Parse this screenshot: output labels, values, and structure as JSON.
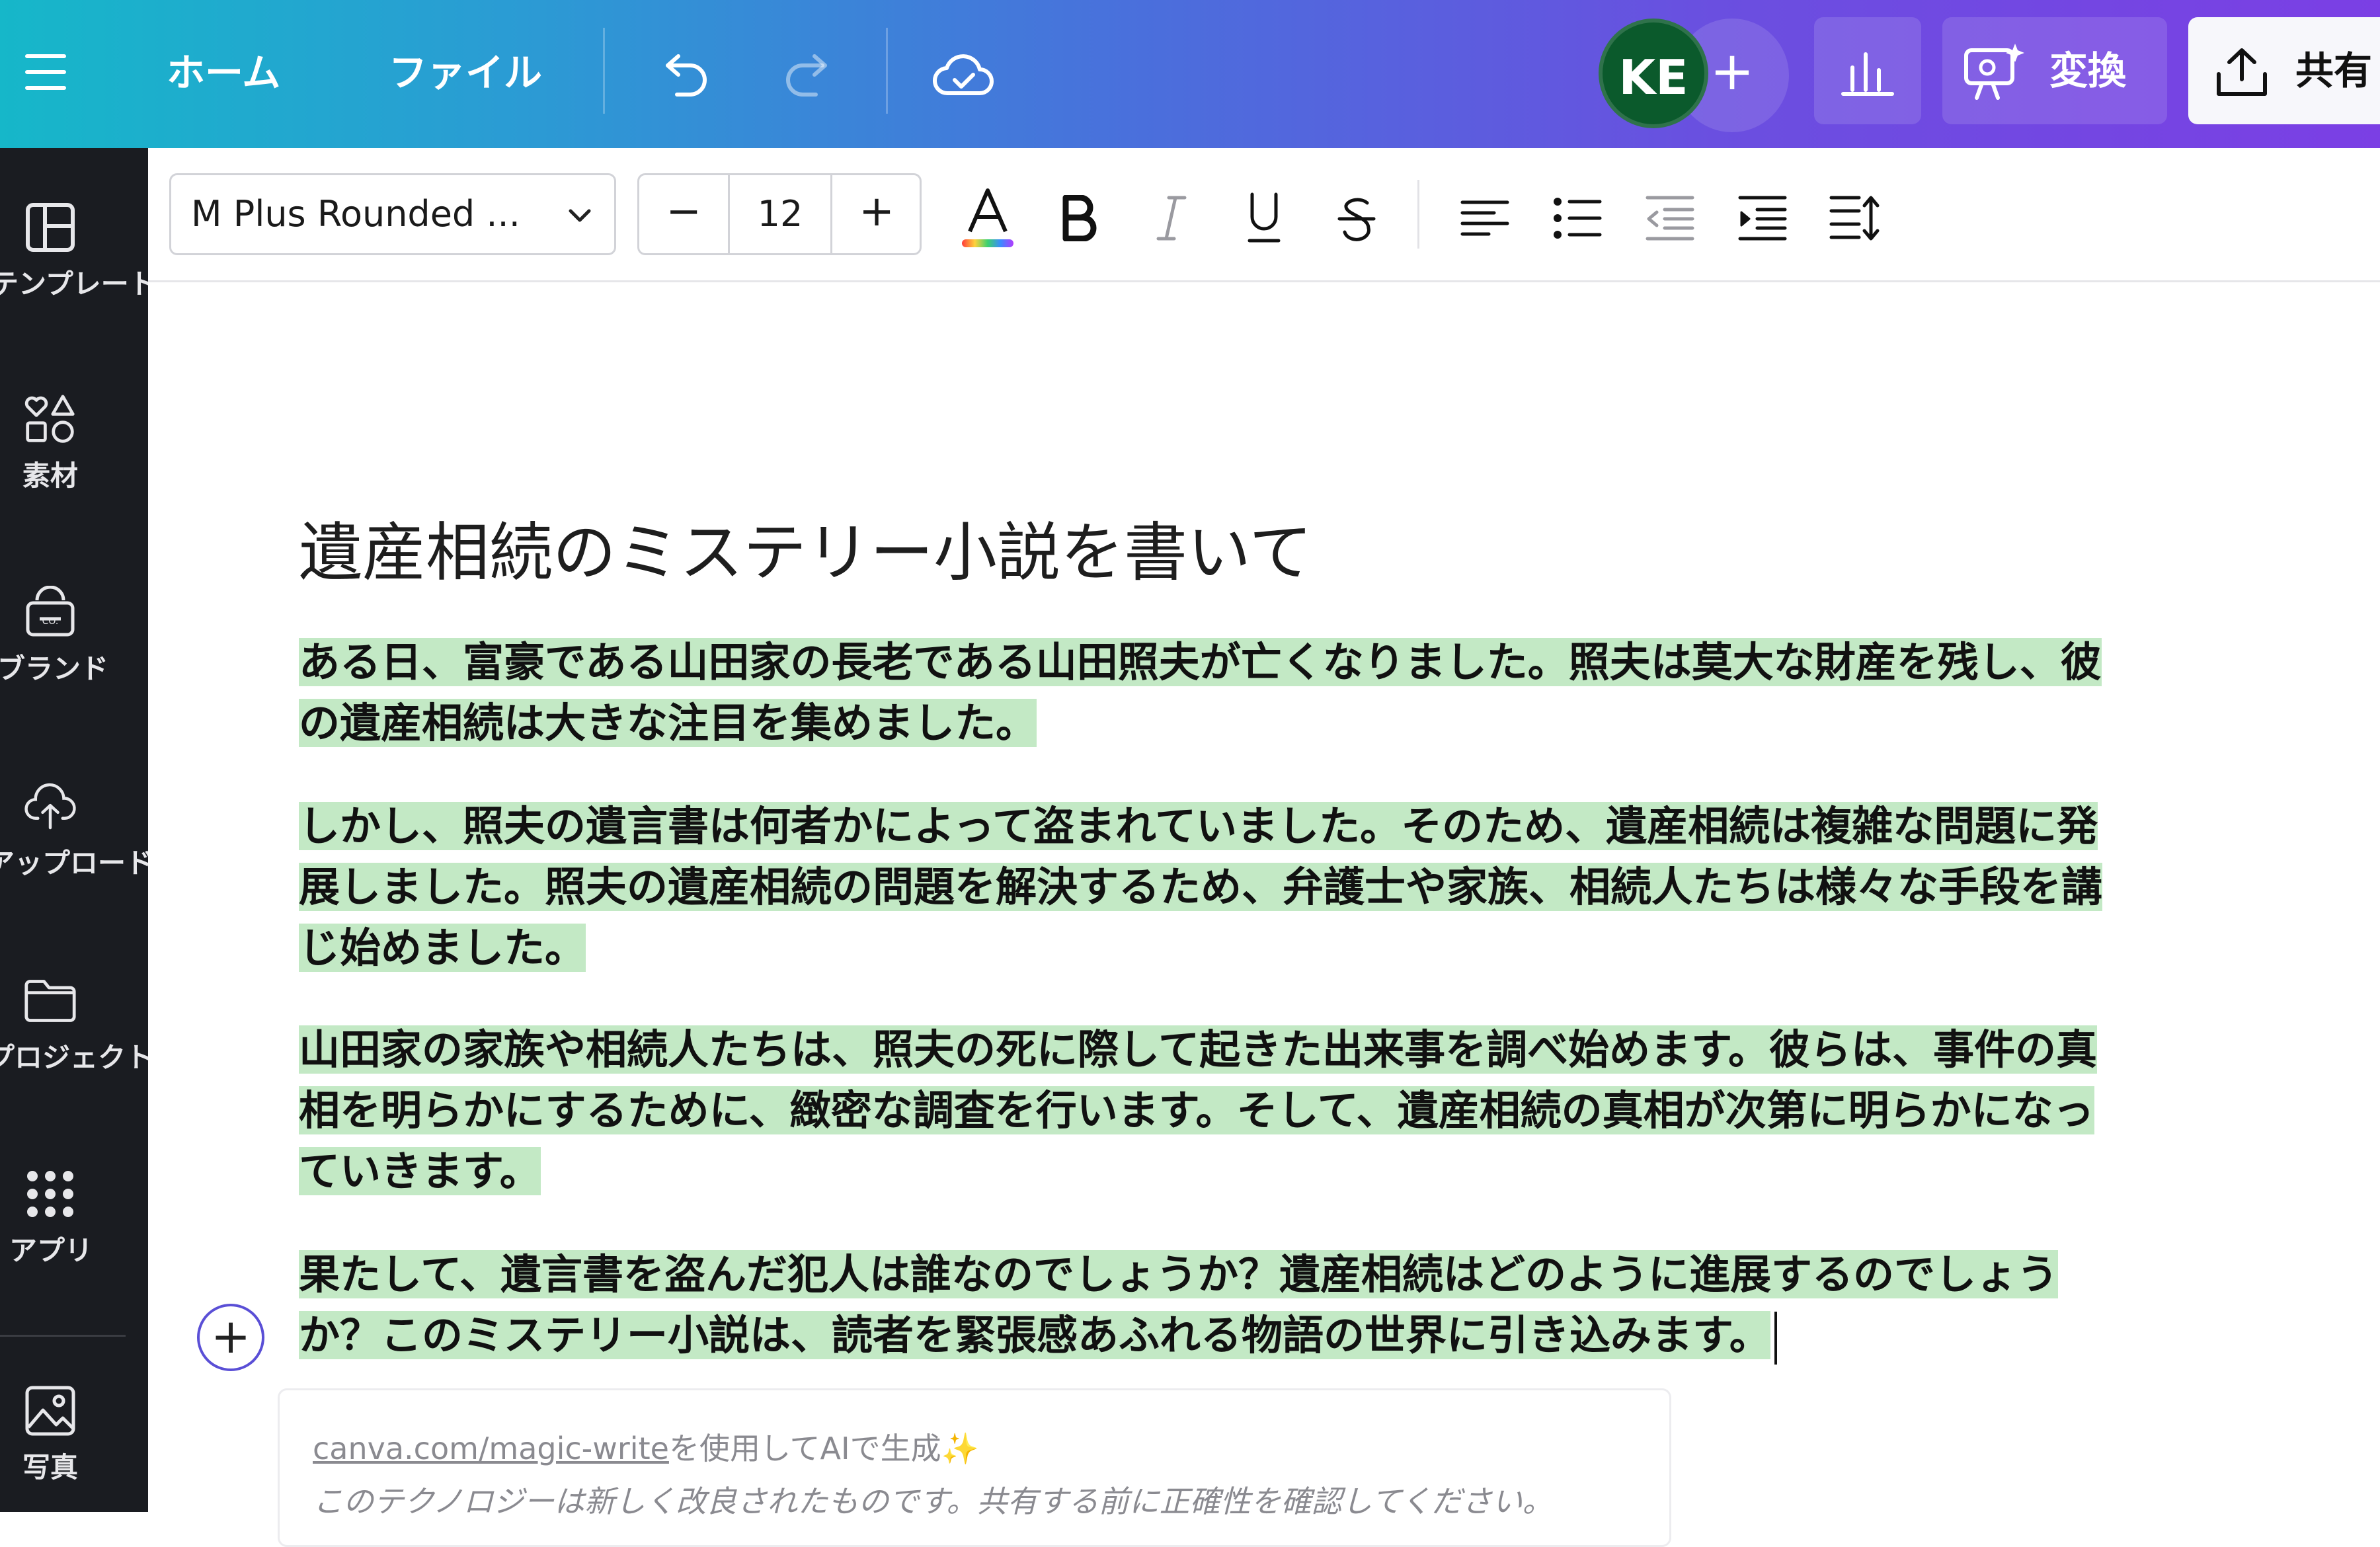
{
  "topbar": {
    "home_label": "ホーム",
    "file_label": "ファイル",
    "avatar_initials": "KE",
    "convert_label": "変換",
    "share_label": "共有"
  },
  "sidebar": {
    "items": [
      {
        "label": "テンプレート",
        "icon": "template-icon"
      },
      {
        "label": "素材",
        "icon": "elements-icon"
      },
      {
        "label": "ブランド",
        "icon": "brand-icon"
      },
      {
        "label": "アップロード",
        "icon": "upload-icon"
      },
      {
        "label": "プロジェクト",
        "icon": "folder-icon"
      },
      {
        "label": "アプリ",
        "icon": "apps-icon"
      },
      {
        "label": "写真",
        "icon": "photo-icon"
      }
    ]
  },
  "toolbar": {
    "font_name": "M Plus Rounded ...",
    "font_size": "12",
    "minus": "−",
    "plus": "+"
  },
  "document": {
    "title": "遺産相続のミステリー小説を書いて",
    "paragraphs": [
      {
        "lines": [
          "ある日、富豪である山田家の長老である山田照夫が亡くなりました。照夫は莫大な財産を残し、彼",
          "の遺産相続は大きな注目を集めました。"
        ]
      },
      {
        "lines": [
          "しかし、照夫の遺言書は何者かによって盗まれていました。そのため、遺産相続は複雑な問題に発",
          "展しました。照夫の遺産相続の問題を解決するため、弁護士や家族、相続人たちは様々な手段を講",
          "じ始めました。"
        ]
      },
      {
        "lines": [
          "山田家の家族や相続人たちは、照夫の死に際して起きた出来事を調べ始めます。彼らは、事件の真",
          "相を明らかにするために、緻密な調査を行います。そして、遺産相続の真相が次第に明らかになっ",
          "ていきます。"
        ]
      },
      {
        "lines": [
          "果たして、遺言書を盗んだ犯人は誰なのでしょうか？遺産相続はどのように進展するのでしょう",
          "か？このミステリー小説は、読者を緊張感あふれる物語の世界に引き込みます。"
        ]
      }
    ]
  },
  "notice": {
    "link_text": "canva.com/magic-write",
    "suffix": "を使用してAIで生成✨",
    "disclaimer": "このテクノロジーは新しく改良されたものです。共有する前に正確性を確認してください。"
  },
  "colors": {
    "highlight": "#c3e9c5",
    "sidebar_bg": "#1a1c21",
    "avatar_bg": "#0b5a2c",
    "accent_ring": "#5a4fd6"
  }
}
